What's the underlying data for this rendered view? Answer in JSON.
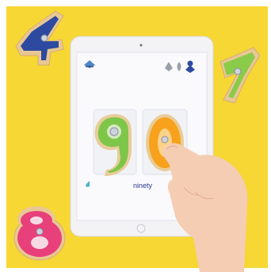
{
  "scene": {
    "app": {
      "digits": [
        "9",
        "0"
      ],
      "caption": "ninety",
      "icons": [
        "parent-menu-icon",
        "settings-icon",
        "leaf-icon",
        "character-icon",
        "sound-icon"
      ]
    },
    "props": {
      "wooden_numbers": [
        "4",
        "7",
        "8"
      ]
    }
  },
  "colors": {
    "background": "#f7d733",
    "digit_9": "#7ec64a",
    "digit_0": "#f7a11c",
    "digit_4": "#2d4aa0",
    "digit_7": "#8acb4a",
    "digit_8": "#e8407a",
    "caption": "#2c3a90"
  }
}
